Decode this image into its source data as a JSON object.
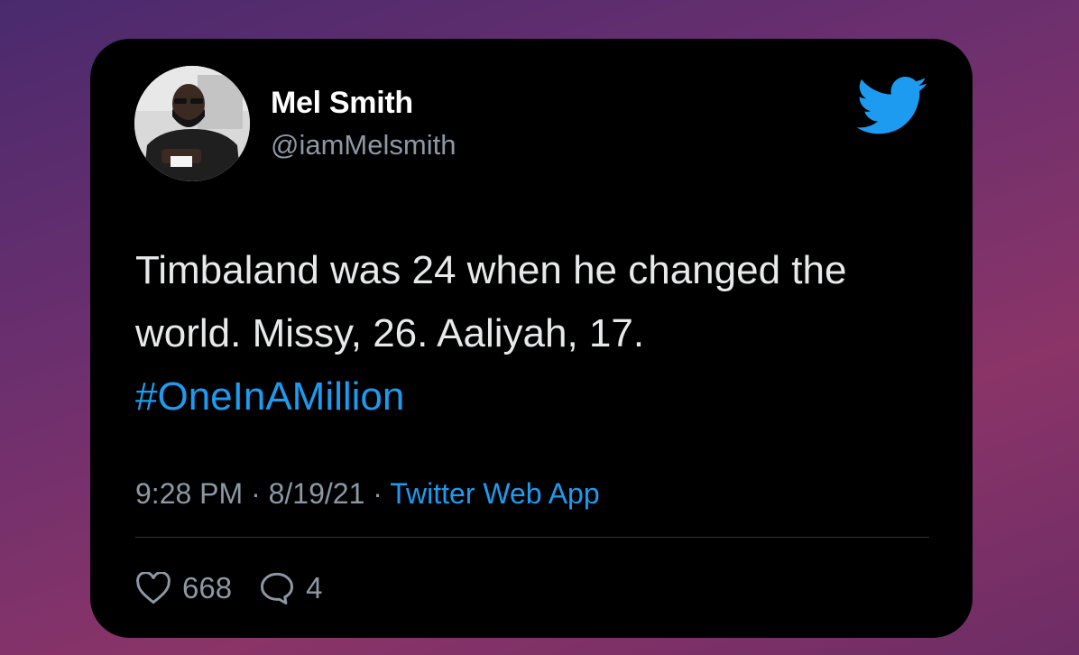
{
  "tweet": {
    "author_name": "Mel Smith",
    "author_handle": "@iamMelsmith",
    "text_plain": "Timbaland was 24 when he changed the world. Missy, 26. Aaliyah, 17.",
    "hashtag": "#OneInAMillion",
    "time": "9:28 PM",
    "date": "8/19/21",
    "separator": "·",
    "source": "Twitter Web App",
    "likes": "668",
    "replies": "4"
  },
  "icons": {
    "brand": "twitter-bird-icon",
    "like": "heart-icon",
    "reply": "speech-bubble-icon"
  },
  "colors": {
    "accent": "#1d9bf0",
    "card_bg": "#000000",
    "text_primary": "#e7e9ea",
    "text_secondary": "#8b98a5"
  }
}
